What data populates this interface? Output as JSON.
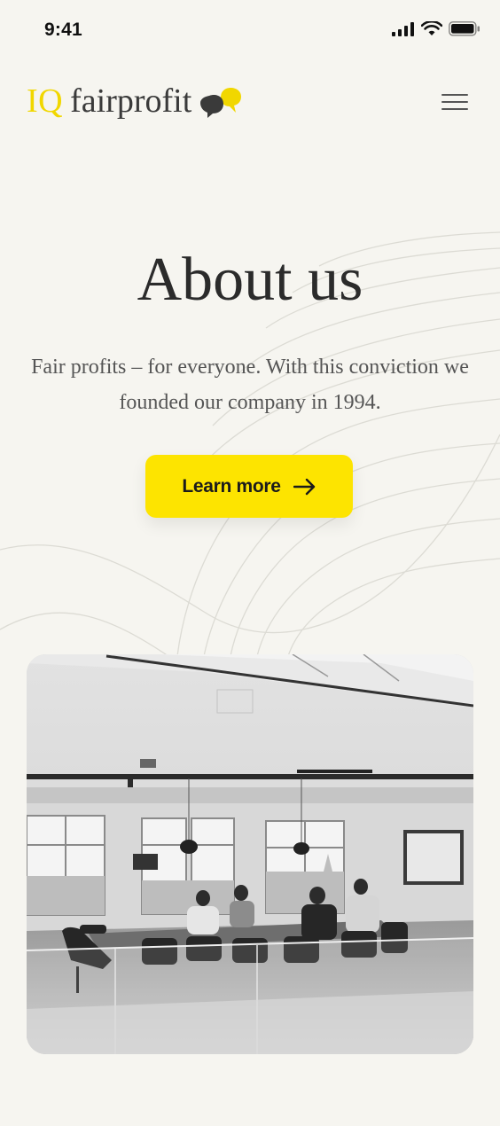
{
  "status_bar": {
    "time": "9:41"
  },
  "header": {
    "logo_iq": "IQ",
    "logo_name": "fairprofit"
  },
  "hero": {
    "title": "About us",
    "lead": "Fair profits – for everyone. With this conviction we founded our company in 1994.",
    "cta_label": "Learn more"
  },
  "colors": {
    "brand_yellow": "#fde400",
    "background": "#f6f5f0",
    "text_dark": "#2b2b2b"
  },
  "icons": [
    "signal-icon",
    "wifi-icon",
    "battery-icon",
    "speech-bubbles-icon",
    "hamburger-menu-icon",
    "arrow-right-icon"
  ]
}
